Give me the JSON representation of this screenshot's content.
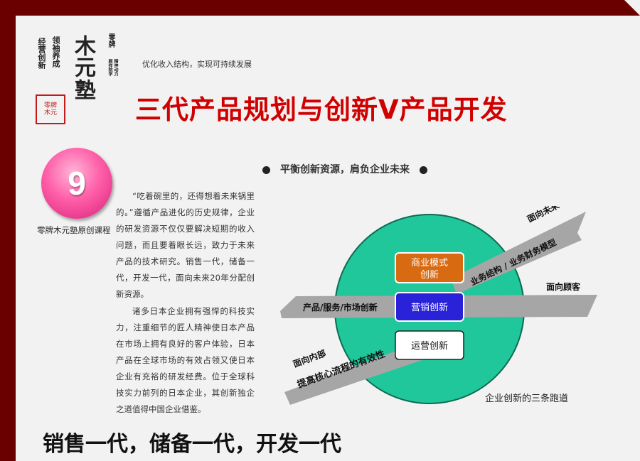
{
  "logo": {
    "left_col": "经营创新",
    "mid_col": "领袖养成",
    "right_col": "零牌",
    "seal": "零牌木元",
    "tag1": "顾祥院学",
    "tag2": "精神动力",
    "char1": "木元",
    "char2": "塾"
  },
  "header": {
    "subtitle": "优化收入结构，实现可持续发展",
    "title": "三代产品规划与创新V产品开发"
  },
  "badge": {
    "number": "9",
    "series": "零牌木元塾原创课程"
  },
  "section": {
    "heading": "平衡创新资源，肩负企业未来"
  },
  "body": {
    "p1": "“吃着碗里的，还得想着未来锅里的。”遵循产品进化的历史规律，企业的研发资源不仅仅要解决短期的收入问题，而且要着眼长远，致力于未来产品的技术研究。销售一代，储备一代，开发一代，面向未来20年分配创新资源。",
    "p2": "诸多日本企业拥有强悍的科技实力，注重细节的匠人精神使日本产品在市场上拥有良好的客户体验，日本产品在全球市场的有效占领又使日本企业有充裕的研发经费。位于全球科技实力前列的日本企业，其创新独企之道值得中国企业借鉴。"
  },
  "diagram": {
    "box1_line1": "商业模式",
    "box1_line2": "创新",
    "box2": "营销创新",
    "box3": "运营创新",
    "arrow_top_label": "面向未来",
    "arrow_top_text": "业务结构 / 业务财务模型",
    "arrow_mid_label": "面向顾客",
    "arrow_mid_text": "产品/服务/市场创新",
    "arrow_bot_label": "面向内部",
    "arrow_bot_text": "提高核心流程的有效性",
    "caption": "企业创新的三条跑道"
  },
  "footer": {
    "tagline": "销售一代，储备一代，开发一代"
  },
  "colors": {
    "frame": "#6b0000",
    "title": "#d10000",
    "circle": "#1fc79b",
    "box1": "#d86a12",
    "box2": "#2a22d8",
    "arrow": "#a6a6a6"
  }
}
